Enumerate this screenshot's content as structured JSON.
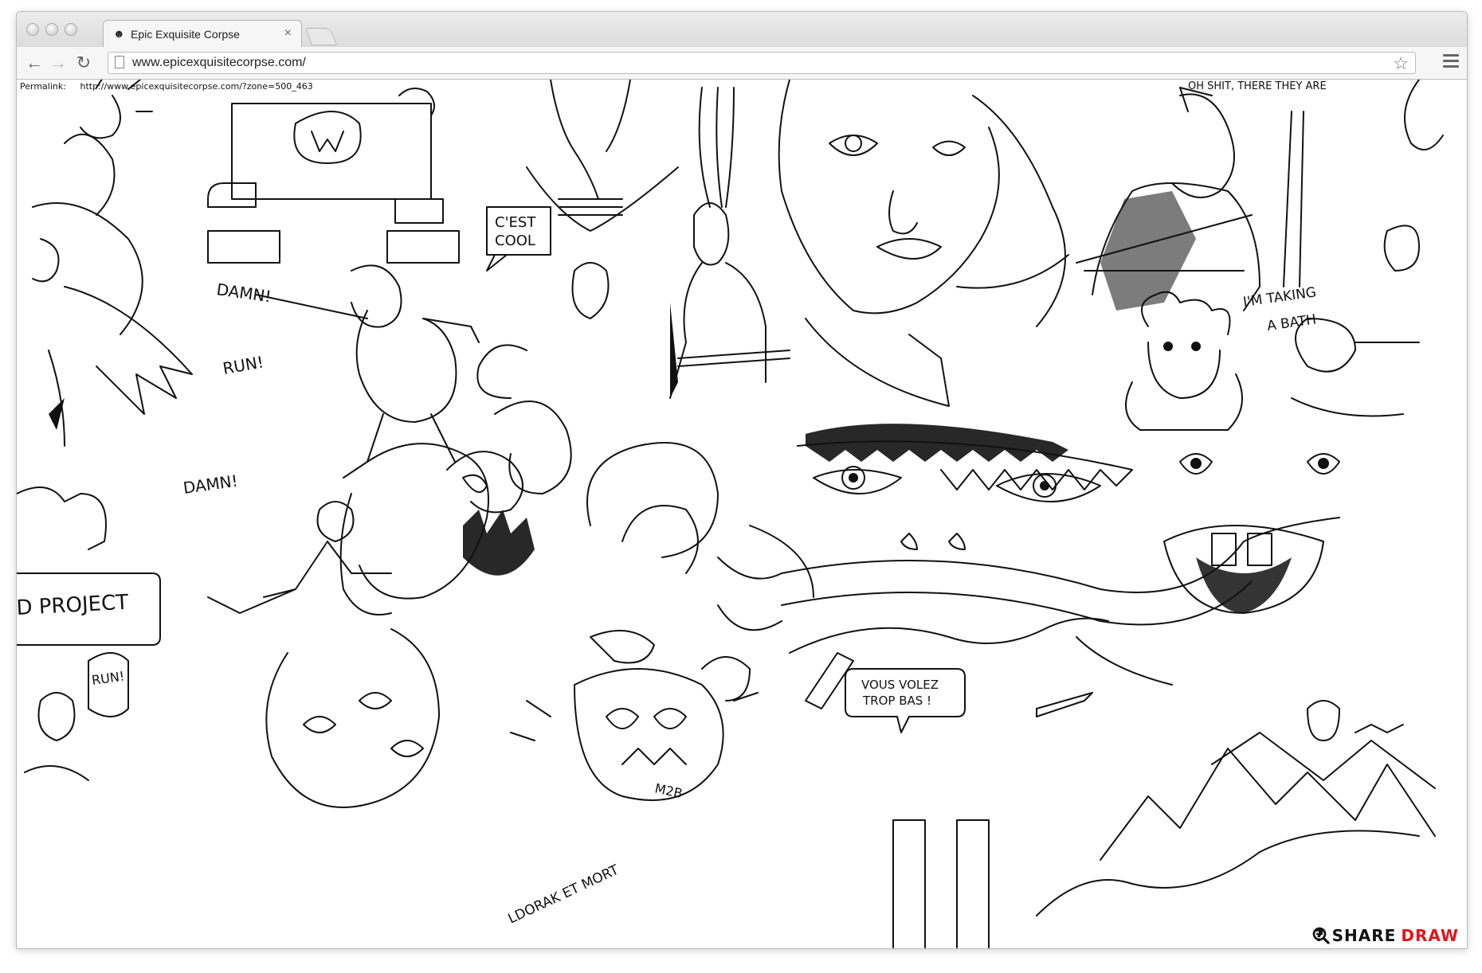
{
  "browser": {
    "tab_title": "Epic Exquisite Corpse",
    "tab_favicon": "smiley-icon",
    "url": "www.epicexquisitecorpse.com/"
  },
  "page": {
    "permalink_label": "Permalink:",
    "permalink_url": "http://www.epicexquisitecorpse.com/?zone=500_463",
    "controls": {
      "zoom_in": "zoom-in-icon",
      "zoom_out": "zoom-out-icon",
      "help": "?",
      "share": "SHARE",
      "draw": "DRAW",
      "draw_color": "#e0161b"
    },
    "drawing_texts": {
      "damn_1": "DAMN!",
      "run_1": "RUN!",
      "damn_2": "DAMN!",
      "run_2": "RUN!",
      "cest_line1": "C'EST",
      "cest_line2": "COOL",
      "bath_line1": "I'M TAKING",
      "bath_line2": "A BATH",
      "project": "D PROJECT",
      "vous_line1": "VOUS VOLEZ",
      "vous_line2": "TROP BAS !",
      "mort": "LDORAK ET MORT",
      "oh_shit": "OH SHIT, THERE THEY ARE",
      "m2b": "M2B"
    }
  }
}
